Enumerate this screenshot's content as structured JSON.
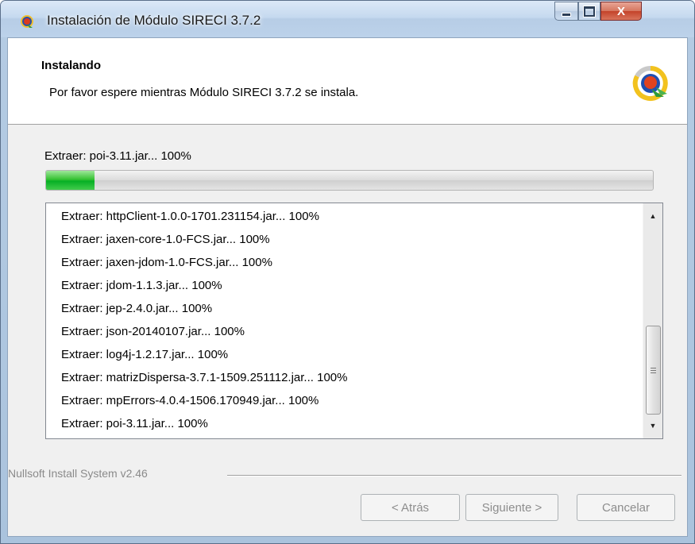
{
  "window": {
    "title": "Instalación de Módulo SIRECI 3.7.2",
    "controls": {
      "close": "X"
    }
  },
  "header": {
    "title": "Instalando",
    "subtitle": "Por favor espere mientras Módulo SIRECI 3.7.2 se instala."
  },
  "status": {
    "text": "Extraer: poi-3.11.jar... 100%",
    "progress_fraction": 0.08
  },
  "log": {
    "lines": [
      "Extraer: httpClient-1.0.0-1701.231154.jar... 100%",
      "Extraer: jaxen-core-1.0-FCS.jar... 100%",
      "Extraer: jaxen-jdom-1.0-FCS.jar... 100%",
      "Extraer: jdom-1.1.3.jar... 100%",
      "Extraer: jep-2.4.0.jar... 100%",
      "Extraer: json-20140107.jar... 100%",
      "Extraer: log4j-1.2.17.jar... 100%",
      "Extraer: matrizDispersa-3.7.1-1509.251112.jar... 100%",
      "Extraer: mpErrors-4.0.4-1506.170949.jar... 100%",
      "Extraer: poi-3.11.jar... 100%"
    ]
  },
  "footer": {
    "brand": "Nullsoft Install System v2.46",
    "buttons": {
      "back": "< Atrás",
      "next": "Siguiente >",
      "cancel": "Cancelar"
    }
  },
  "colors": {
    "progress_green": "#06b025",
    "title_bar": "#c5d9ef",
    "close_red": "#c4432a"
  },
  "icons": [
    "app-icon",
    "sireci-logo-icon",
    "minimize-icon",
    "maximize-icon",
    "close-icon",
    "scroll-up-icon",
    "scroll-down-icon"
  ]
}
